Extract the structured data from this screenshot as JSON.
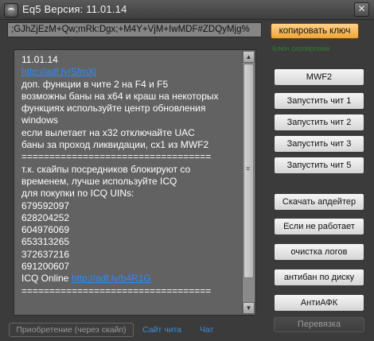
{
  "window": {
    "title": "Eq5 Версия: 11.01.14"
  },
  "key": {
    "value": ";GJhZjEzM+Qw;mRk:Dgx;+M4Y+VjM+IwMDF#ZDQyMjg%",
    "copy_label": "копировать ключ",
    "copy_status": "Ключ скопирован"
  },
  "news": {
    "lines": [
      {
        "text": "11.01.14"
      },
      {
        "link": "http://adf.ly/SfmXj"
      },
      {
        "text": "доп. функции в чите 2 на F4 и F5"
      },
      {
        "text": "возможны баны на x64 и краш на некоторых"
      },
      {
        "text": "функциях используйте центр обновления"
      },
      {
        "text": "windows"
      },
      {
        "text": "если вылетает на x32 отключайте UAC"
      },
      {
        "text": "баны за проход ликвидации, сх1 из MWF2"
      },
      {
        "text": "=================================="
      },
      {
        "text": "т.к. скайпы посредников блокируют со"
      },
      {
        "text": "временем, лучше используйте ICQ"
      },
      {
        "text": "для покупки по ICQ UINs:"
      },
      {
        "text": "679592097"
      },
      {
        "text": "628204252"
      },
      {
        "text": "604976069"
      },
      {
        "text": "653313265"
      },
      {
        "text": "372637216"
      },
      {
        "text": "691200607"
      },
      {
        "text": "ICQ Online ",
        "link": "http://adf.ly/b4R1G"
      },
      {
        "text": "=================================="
      }
    ]
  },
  "buttons": {
    "mwf2": "MWF2",
    "cheat1": "Запустить чит 1",
    "cheat2": "Запустить чит 2",
    "cheat3": "Запустить чит 3",
    "cheat5": "Запустить чит 5",
    "updater": "Скачать апдейтер",
    "not_working": "Если не работает",
    "clear_logs": "очистка логов",
    "antiban": "антибан по диску",
    "antiafk": "АнтиАФК",
    "binding": "Перевязка"
  },
  "footer": {
    "purchase": "Приобретение (через скайп)",
    "site": "Сайт чита",
    "chat": "Чат"
  },
  "colors": {
    "accent": "#f5b04a",
    "link": "#2d8cff",
    "panel": "#626262",
    "background": "#3b3b3b"
  },
  "icons": {
    "app": "eq5-logo-icon",
    "close": "close-icon"
  }
}
